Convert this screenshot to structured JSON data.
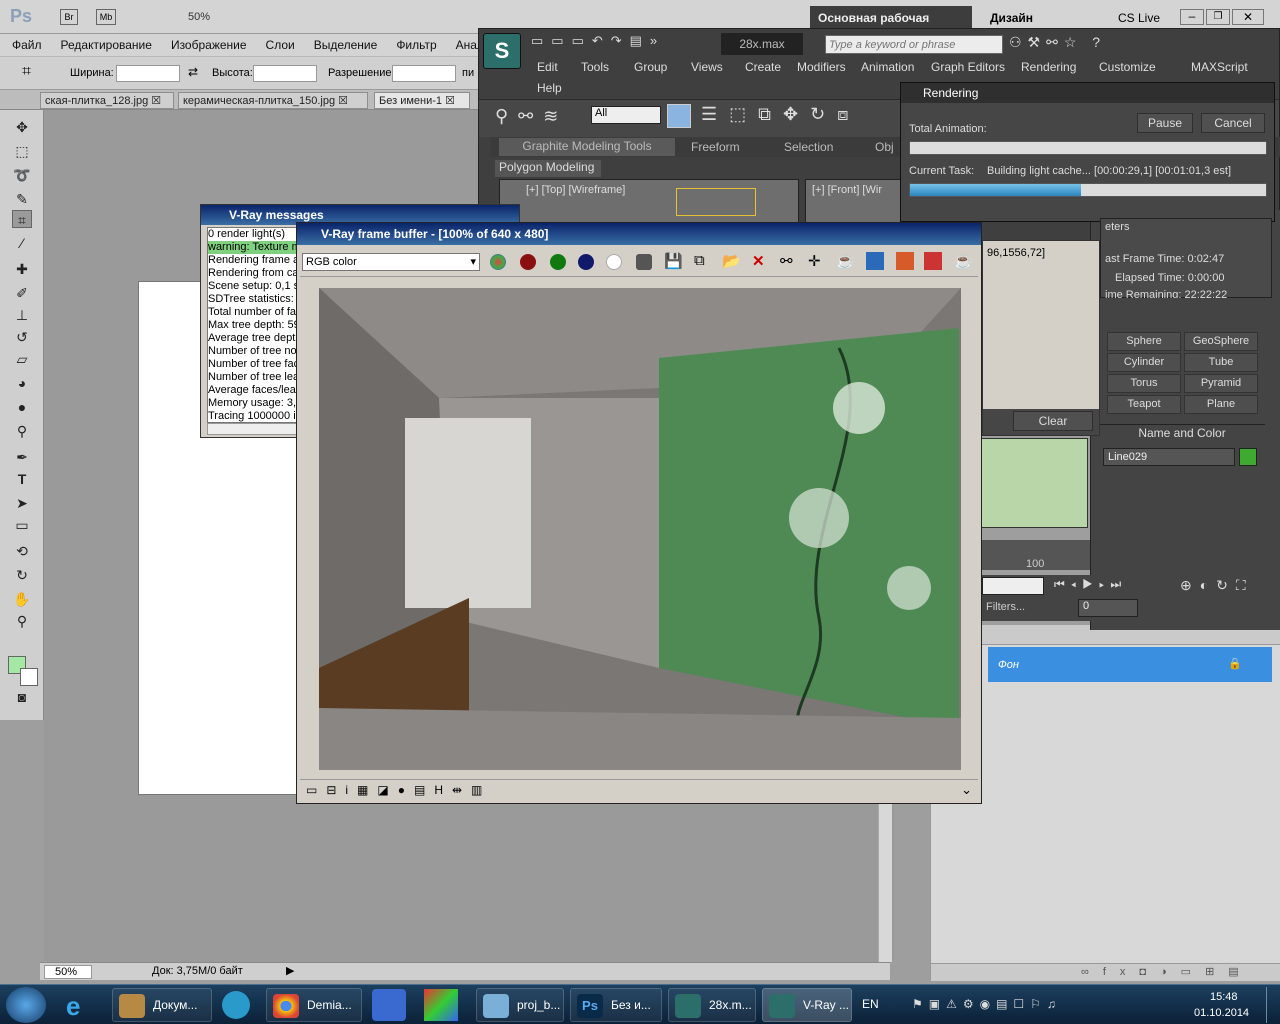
{
  "photoshop": {
    "logo": "Ps",
    "zoom": "50%",
    "workspace_active": "Основная рабочая среда",
    "workspace_design": "Дизайн",
    "cs_live": "CS Live",
    "menu": [
      "Файл",
      "Редактирование",
      "Изображение",
      "Слои",
      "Выделение",
      "Фильтр",
      "Анал"
    ],
    "options": {
      "width_label": "Ширина:",
      "height_label": "Высота:",
      "resolution_label": "Разрешение:",
      "extra": "пи"
    },
    "tabs": [
      "ская-плитка_128.jpg",
      "керамическая-плитка_150.jpg",
      "Без имени-1"
    ],
    "status_zoom": "50%",
    "status_doc": "Док: 3,75M/0 байт",
    "layer_name": "Фон"
  },
  "max": {
    "title": "28x.max",
    "search_placeholder": "Type a keyword or phrase",
    "menu": [
      "Edit",
      "Tools",
      "Group",
      "Views",
      "Create",
      "Modifiers",
      "Animation",
      "Graph Editors",
      "Rendering",
      "Customize",
      "MAXScript"
    ],
    "help": "Help",
    "selection_filter": "All",
    "ribbon_tabs": [
      "Graphite Modeling Tools",
      "Freeform",
      "Selection",
      "Obj"
    ],
    "ribbon_panel": "Polygon Modeling",
    "viewport_top": "[+] [Top] [Wireframe]",
    "viewport_front": "[+] [Front] [Wir",
    "primitives": [
      "Sphere",
      "GeoSphere",
      "Cylinder",
      "Tube",
      "Torus",
      "Pyramid",
      "Teapot",
      "Plane"
    ],
    "name_color_label": "Name and Color",
    "object_name": "Line029",
    "object_color": "#3faa30",
    "timeline_value": "100",
    "frame_value": "0",
    "filters_label": "Filters...",
    "log_coords": "96,1556,72]",
    "clear_label": "Clear",
    "params_label": "eters"
  },
  "rendering": {
    "title": "Rendering",
    "total_animation_label": "Total Animation:",
    "pause": "Pause",
    "cancel": "Cancel",
    "current_task_label": "Current Task:",
    "current_task": "Building light cache... [00:00:29,1] [00:01:01,3 est]",
    "task_progress": 0.48,
    "last_frame": "ast Frame Time:  0:02:47",
    "elapsed": "Elapsed Time:  0:00:00",
    "remaining": "ime Remaining: 22:22:22"
  },
  "vray_messages": {
    "title": "V-Ray messages",
    "lines": [
      "0 render light(s)",
      "warning: Texture m",
      "Rendering frame a",
      "Rendering from ca",
      "Scene setup: 0,1 s",
      "SDTree statistics:",
      "Total number of fac",
      "Max tree depth: 59",
      "Average tree depth",
      "Number of tree nod",
      "Number of tree fac",
      "Number of tree leaf",
      "Average faces/leaf",
      "Memory usage: 3,9",
      "Tracing 1000000 ir"
    ]
  },
  "vfb": {
    "title": "V-Ray frame buffer - [100% of 640 x 480]",
    "channel": "RGB color"
  },
  "taskbar": {
    "tasks": [
      "Докум...",
      "Demia...",
      "proj_b...",
      "Без и...",
      "28x.m...",
      "V-Ray ..."
    ],
    "lang": "EN",
    "time": "15:48",
    "date": "01.10.2014"
  }
}
